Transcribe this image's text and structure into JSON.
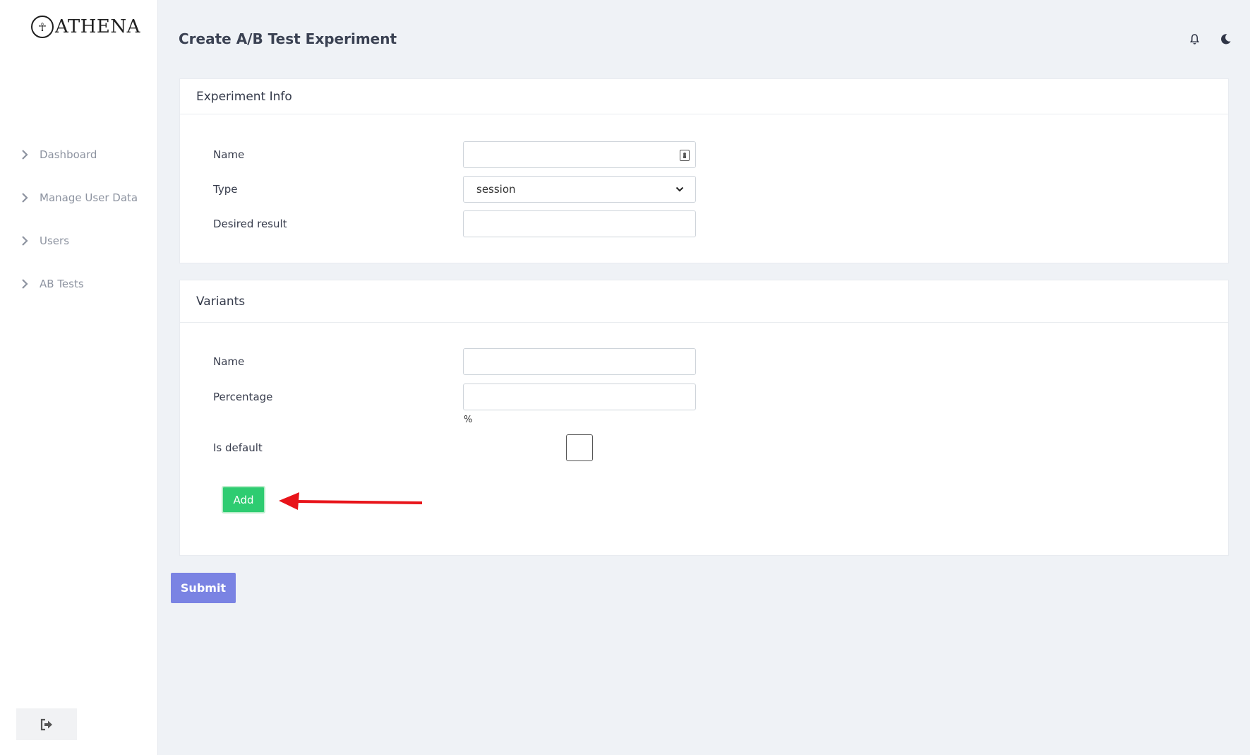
{
  "app": {
    "logo_text": "ATHENA",
    "logo_mark": "☥"
  },
  "sidebar": {
    "items": [
      {
        "label": "Dashboard",
        "icon": "chevron-right-icon"
      },
      {
        "label": "Manage User Data",
        "icon": "chevron-right-icon"
      },
      {
        "label": "Users",
        "icon": "chevron-right-icon"
      },
      {
        "label": "AB Tests",
        "icon": "chevron-right-icon"
      }
    ],
    "logout_icon": "logout-icon"
  },
  "header": {
    "title": "Create A/B Test Experiment",
    "icons": [
      "bell-icon",
      "moon-icon"
    ]
  },
  "experiment_info": {
    "heading": "Experiment Info",
    "name_label": "Name",
    "name_value": "",
    "type_label": "Type",
    "type_value": "session",
    "desired_result_label": "Desired result",
    "desired_result_value": ""
  },
  "variants": {
    "heading": "Variants",
    "name_label": "Name",
    "name_value": "",
    "percentage_label": "Percentage",
    "percentage_value": "",
    "percent_symbol": "%",
    "is_default_label": "Is default",
    "is_default_checked": false,
    "add_label": "Add"
  },
  "submit_label": "Submit",
  "colors": {
    "add_button": "#2ecc71",
    "submit_button": "#7a83e3",
    "annotation_arrow": "#e8141a",
    "background": "#eff2f6"
  }
}
